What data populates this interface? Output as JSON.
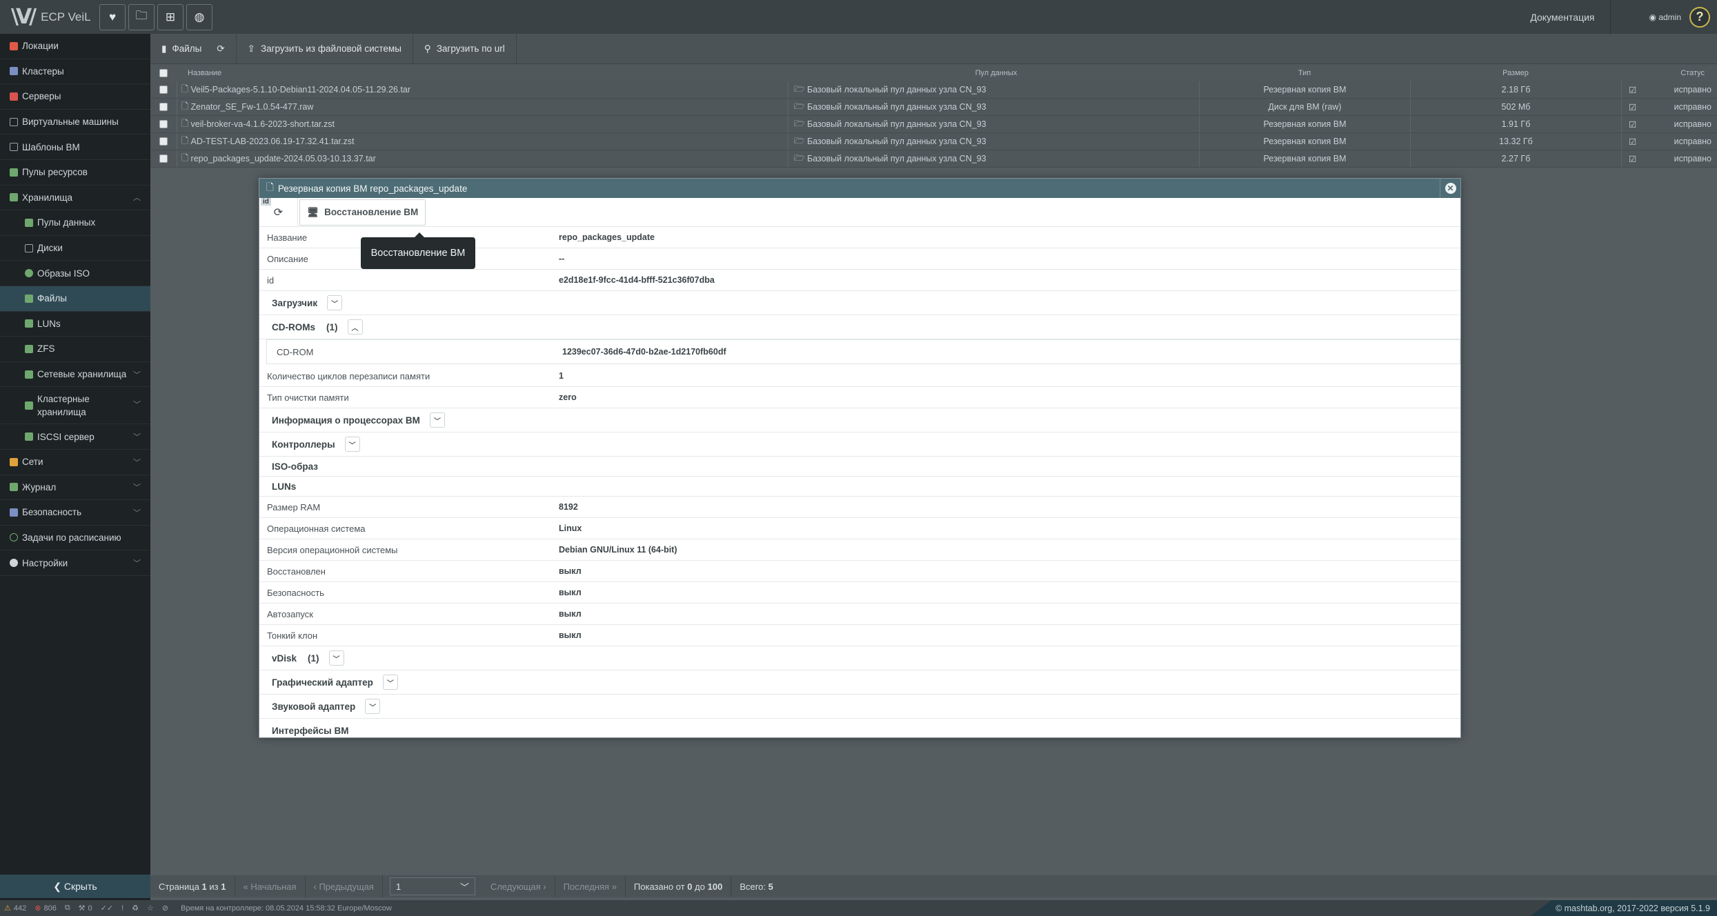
{
  "app": {
    "logo_text": "ECP VeiL",
    "docs_label": "Документация",
    "user": "admin",
    "help": "?"
  },
  "sidebar": {
    "items": [
      {
        "label": "Локации",
        "icon": "location-arrow-icon",
        "color": "#e05a47"
      },
      {
        "label": "Кластеры",
        "icon": "cluster-icon",
        "color": "#7b8fc4"
      },
      {
        "label": "Серверы",
        "icon": "server-icon",
        "color": "#d9534f"
      },
      {
        "label": "Виртуальные машины",
        "icon": "desktop-icon",
        "color": "#9aa5aa"
      },
      {
        "label": "Шаблоны ВМ",
        "icon": "template-icon",
        "color": "#9aa5aa"
      },
      {
        "label": "Пулы ресурсов",
        "icon": "resource-pool-icon",
        "color": "#6fa86f"
      },
      {
        "label": "Хранилища",
        "icon": "storage-icon",
        "color": "#6fa86f"
      },
      {
        "label": "Пулы данных",
        "icon": "folder-open-icon",
        "color": "#6fa86f"
      },
      {
        "label": "Диски",
        "icon": "disk-icon",
        "color": "#9aa5aa"
      },
      {
        "label": "Образы ISO",
        "icon": "iso-icon",
        "color": "#6fa86f"
      },
      {
        "label": "Файлы",
        "icon": "file-icon",
        "color": "#6fa86f"
      },
      {
        "label": "LUNs",
        "icon": "lun-icon",
        "color": "#6fa86f"
      },
      {
        "label": "ZFS",
        "icon": "zfs-icon",
        "color": "#6fa86f"
      },
      {
        "label": "Сетевые хранилища",
        "icon": "network-storage-icon",
        "color": "#6fa86f"
      },
      {
        "label": "Кластерные хранилища",
        "icon": "cluster-storage-icon",
        "color": "#6fa86f"
      },
      {
        "label": "ISCSI сервер",
        "icon": "iscsi-icon",
        "color": "#6fa86f"
      },
      {
        "label": "Сети",
        "icon": "network-icon",
        "color": "#e0a23a"
      },
      {
        "label": "Журнал",
        "icon": "journal-icon",
        "color": "#6fa86f"
      },
      {
        "label": "Безопасность",
        "icon": "shield-icon",
        "color": "#7b8fc4"
      },
      {
        "label": "Задачи по расписанию",
        "icon": "clock-icon",
        "color": "#6fa86f"
      },
      {
        "label": "Настройки",
        "icon": "gear-icon",
        "color": "#cfd6da"
      }
    ],
    "hide_label": "Скрыть"
  },
  "toolbar": {
    "files_label": "Файлы",
    "upload_fs_label": "Загрузить из файловой системы",
    "upload_url_label": "Загрузить по url"
  },
  "grid": {
    "headers": {
      "name": "Название",
      "pool": "Пул данных",
      "type": "Тип",
      "size": "Размер",
      "status": "Статус"
    },
    "rows": [
      {
        "name": "Veil5-Packages-5.1.10-Debian11-2024.04.05-11.29.26.tar",
        "pool": "Базовый локальный пул данных узла CN_93",
        "type": "Резервная копия ВМ",
        "size": "2.18 Гб",
        "status": "исправно"
      },
      {
        "name": "Zenator_SE_Fw-1.0.54-477.raw",
        "pool": "Базовый локальный пул данных узла CN_93",
        "type": "Диск для ВМ (raw)",
        "size": "502 Мб",
        "status": "исправно"
      },
      {
        "name": "veil-broker-va-4.1.6-2023-short.tar.zst",
        "pool": "Базовый локальный пул данных узла CN_93",
        "type": "Резервная копия ВМ",
        "size": "1.91 Гб",
        "status": "исправно"
      },
      {
        "name": "AD-TEST-LAB-2023.06.19-17.32.41.tar.zst",
        "pool": "Базовый локальный пул данных узла CN_93",
        "type": "Резервная копия ВМ",
        "size": "13.32 Гб",
        "status": "исправно"
      },
      {
        "name": "repo_packages_update-2024.05.03-10.13.37.tar",
        "pool": "Базовый локальный пул данных узла CN_93",
        "type": "Резервная копия ВМ",
        "size": "2.27 Гб",
        "status": "исправно"
      }
    ]
  },
  "pager": {
    "page_text": "Страница",
    "page_num": "1",
    "of_text": "из",
    "total_pages": "1",
    "first": "Начальная",
    "prev": "Предыдущая",
    "select": "1",
    "next": "Следующая",
    "last": "Последняя",
    "shown": "Показано от",
    "from": "0",
    "to_text": "до",
    "to": "100",
    "total_label": "Всего:",
    "total": "5"
  },
  "statusbar": {
    "warn": "442",
    "err": "806",
    "a": "0",
    "time": "Время на контроллере: 08.05.2024 15:58:32 Europe/Moscow",
    "copy": "© mashtab.org, 2017-2022 версия 5.1.9"
  },
  "modal": {
    "title": "Резервная копия ВМ repo_packages_update",
    "restore_label": "Восстановление ВМ",
    "id_tag": "id",
    "tooltip": "Восстановление ВМ",
    "props1": [
      {
        "label": "Название",
        "value": "repo_packages_update"
      },
      {
        "label": "Описание",
        "value": "--"
      },
      {
        "label": "id",
        "value": "e2d18e1f-9fcc-41d4-bfff-521c36f07dba"
      }
    ],
    "bootloader": "Загрузчик",
    "cdroms": {
      "label": "CD-ROMs",
      "count": "(1)",
      "item_label": "CD-ROM",
      "item_value": "1239ec07-36d6-47d0-b2ae-1d2170fb60df"
    },
    "props2": [
      {
        "label": "Количество циклов перезаписи памяти",
        "value": "1"
      },
      {
        "label": "Тип очистки памяти",
        "value": "zero"
      }
    ],
    "cpu_info": "Информация о процессорах ВМ",
    "controllers": "Контроллеры",
    "iso": "ISO-образ",
    "luns": "LUNs",
    "props3": [
      {
        "label": "Размер RAM",
        "value": "8192"
      },
      {
        "label": "Операционная система",
        "value": "Linux"
      },
      {
        "label": "Версия операционной системы",
        "value": "Debian GNU/Linux 11 (64-bit)"
      },
      {
        "label": "Восстановлен",
        "value": "выкл"
      },
      {
        "label": "Безопасность",
        "value": "выкл"
      },
      {
        "label": "Автозапуск",
        "value": "выкл"
      },
      {
        "label": "Тонкий клон",
        "value": "выкл"
      }
    ],
    "vdisk": {
      "label": "vDisk",
      "count": "(1)"
    },
    "graphics": "Графический адаптер",
    "sound": "Звуковой адаптер",
    "interfaces": "Интерфейсы ВМ"
  }
}
